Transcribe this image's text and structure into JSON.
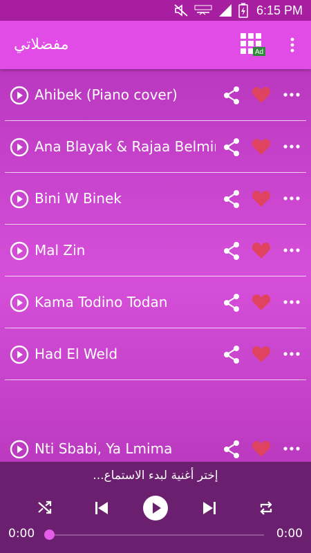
{
  "status_bar": {
    "time": "6:15 PM",
    "icons": [
      "mute-icon",
      "network-icon",
      "signal-icon",
      "battery-icon"
    ]
  },
  "app_bar": {
    "title": "مفضلاتي",
    "ad_badge": "Ad",
    "icons": [
      "apps-grid-icon",
      "more-vert-icon"
    ]
  },
  "songs": [
    {
      "title": "Ahibek (Piano cover)"
    },
    {
      "title": "Ana Blayak & Rajaa Belmir"
    },
    {
      "title": "Bini W Binek"
    },
    {
      "title": "Mal Zin"
    },
    {
      "title": "Kama Todino Todan"
    },
    {
      "title": "Had El Weld"
    },
    {
      "title": "Nti Sbabi, Ya Lmima"
    }
  ],
  "colors": {
    "app_bar": "#e14ce6",
    "status_bar": "#a71ea0",
    "player": "#6b1f6f",
    "heart": "#e0435f",
    "accent": "#e55ce8"
  },
  "player": {
    "hint": "إختر أغنية لبدء الاستماع...",
    "current_time": "0:00",
    "total_time": "0:00",
    "progress": 0,
    "icons": [
      "shuffle-icon",
      "skip-previous-icon",
      "play-icon",
      "skip-next-icon",
      "repeat-icon"
    ]
  }
}
